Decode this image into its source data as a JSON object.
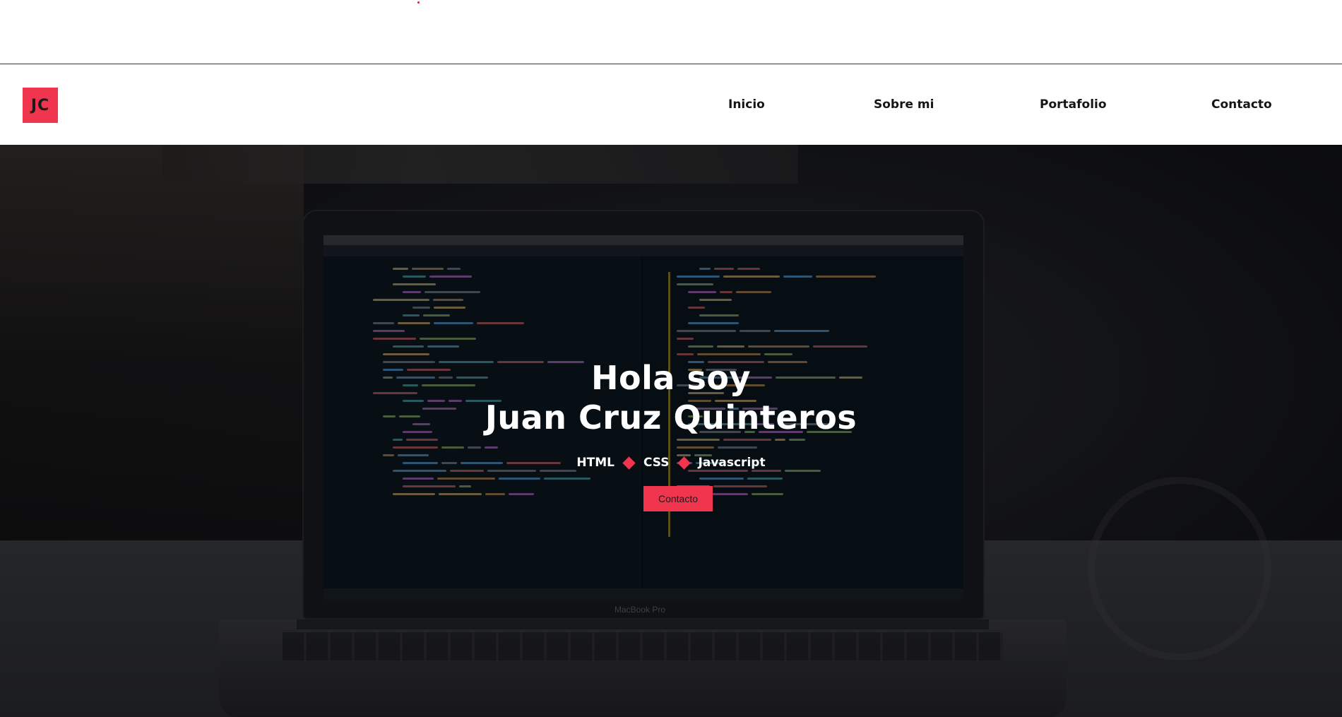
{
  "brand": {
    "logo_text": "JC",
    "accent_color": "#f0364f"
  },
  "nav": {
    "items": [
      {
        "label": "Inicio"
      },
      {
        "label": "Sobre mi"
      },
      {
        "label": "Portafolio"
      },
      {
        "label": "Contacto"
      }
    ]
  },
  "hero": {
    "title_line1": "Hola soy",
    "title_line2": "Juan Cruz Quinteros",
    "skills": [
      "HTML",
      "CSS",
      "Javascript"
    ],
    "cta_label": "Contacto",
    "background_photo": "laptop showing code editor",
    "laptop_label": "MacBook Pro"
  }
}
